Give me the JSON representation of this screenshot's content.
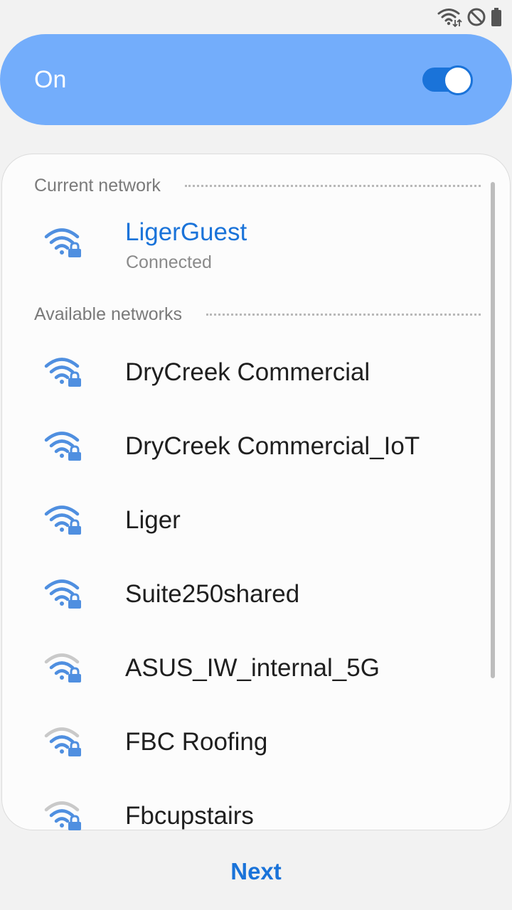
{
  "status_bar": {
    "icons": [
      "wifi-data-icon",
      "blocked-icon",
      "battery-icon"
    ]
  },
  "wifi_toggle": {
    "label": "On",
    "enabled": true,
    "accent_color": "#73adfb",
    "switch_color": "#1a73d9"
  },
  "current_network": {
    "section_title": "Current network",
    "name": "LigerGuest",
    "status": "Connected",
    "signal": "strong",
    "secured": true,
    "name_color": "#1a73d9"
  },
  "available_networks": {
    "section_title": "Available networks",
    "items": [
      {
        "name": "DryCreek Commercial",
        "signal": "strong",
        "secured": true
      },
      {
        "name": "DryCreek Commercial_IoT",
        "signal": "strong",
        "secured": true
      },
      {
        "name": "Liger",
        "signal": "strong",
        "secured": true
      },
      {
        "name": "Suite250shared",
        "signal": "strong",
        "secured": true
      },
      {
        "name": "ASUS_IW_internal_5G",
        "signal": "weak",
        "secured": true
      },
      {
        "name": "FBC Roofing",
        "signal": "weak",
        "secured": true
      },
      {
        "name": "Fbcupstairs",
        "signal": "weak",
        "secured": true
      }
    ]
  },
  "footer": {
    "next_label": "Next"
  }
}
